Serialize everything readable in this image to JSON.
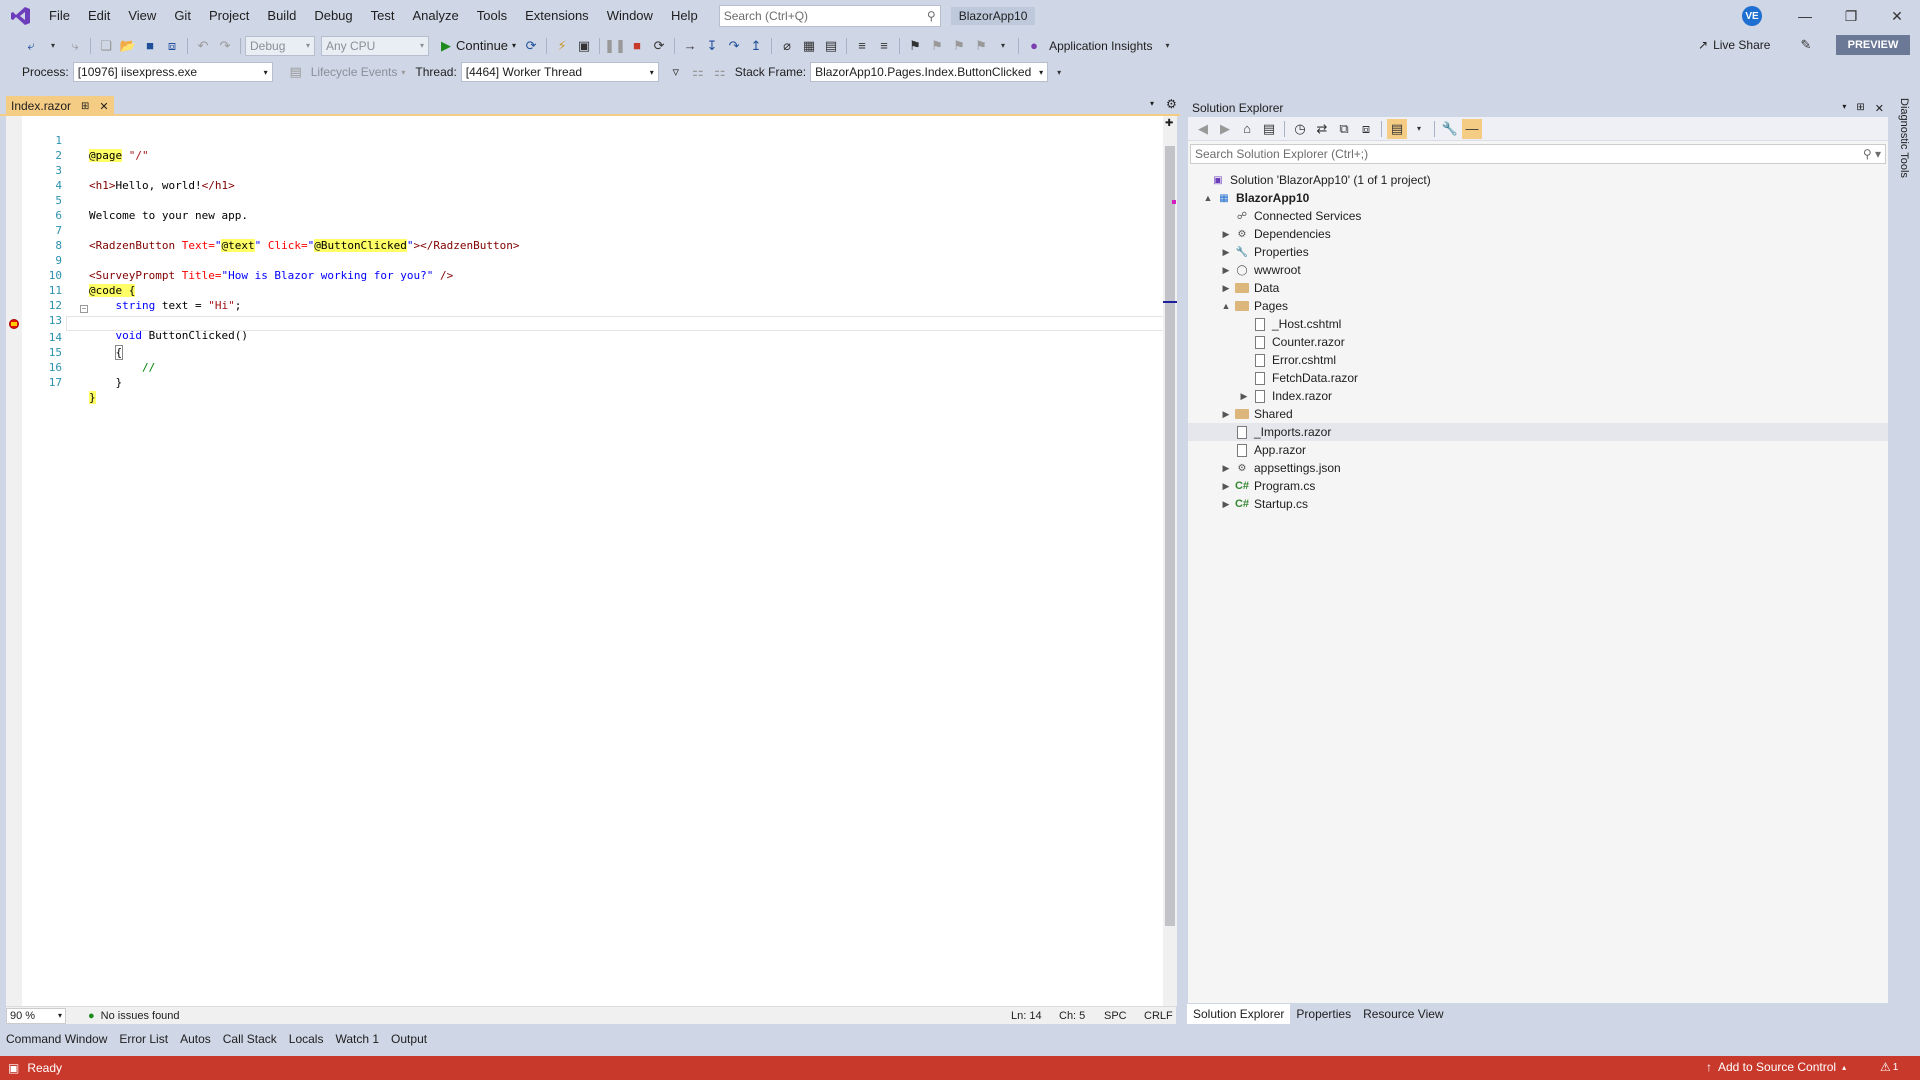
{
  "menu": {
    "items": [
      "File",
      "Edit",
      "View",
      "Git",
      "Project",
      "Build",
      "Debug",
      "Test",
      "Analyze",
      "Tools",
      "Extensions",
      "Window",
      "Help"
    ],
    "search_placeholder": "Search (Ctrl+Q)",
    "app_title": "BlazorApp10",
    "avatar": "VE"
  },
  "toolbar": {
    "config": "Debug",
    "platform": "Any CPU",
    "continue_label": "Continue",
    "app_insights": "Application Insights",
    "live_share": "Live Share",
    "preview": "PREVIEW"
  },
  "debug_toolbar": {
    "process_label": "Process:",
    "process_value": "[10976] iisexpress.exe",
    "lifecycle_label": "Lifecycle Events",
    "thread_label": "Thread:",
    "thread_value": "[4464] Worker Thread",
    "stack_label": "Stack Frame:",
    "stack_value": "BlazorApp10.Pages.Index.ButtonClicked"
  },
  "editor": {
    "tab_title": "Index.razor",
    "line_numbers": [
      "1",
      "2",
      "3",
      "4",
      "5",
      "6",
      "7",
      "8",
      "9",
      "10",
      "11",
      "12",
      "13",
      "14",
      "15",
      "16",
      "17"
    ],
    "zoom": "90 %",
    "issues": "No issues found",
    "ln": "Ln: 14",
    "ch": "Ch: 5",
    "spc": "SPC",
    "crlf": "CRLF"
  },
  "bottom_tabs": [
    "Command Window",
    "Error List",
    "Autos",
    "Call Stack",
    "Locals",
    "Watch 1",
    "Output"
  ],
  "status": {
    "ready": "Ready",
    "source_control": "Add to Source Control",
    "notifications": "1"
  },
  "solution_explorer": {
    "title": "Solution Explorer",
    "search_placeholder": "Search Solution Explorer (Ctrl+;)",
    "tree": [
      {
        "label": "Solution 'BlazorApp10' (1 of 1 project)",
        "level": 0,
        "expander": "",
        "icon": "solution-icon"
      },
      {
        "label": "BlazorApp10",
        "level": 1,
        "expander": "▲",
        "icon": "project-icon"
      },
      {
        "label": "Connected Services",
        "level": 2,
        "expander": "",
        "icon": "connected-services-icon"
      },
      {
        "label": "Dependencies",
        "level": 2,
        "expander": "▶",
        "icon": "dependencies-icon"
      },
      {
        "label": "Properties",
        "level": 2,
        "expander": "▶",
        "icon": "properties-icon"
      },
      {
        "label": "wwwroot",
        "level": 2,
        "expander": "▶",
        "icon": "globe-icon"
      },
      {
        "label": "Data",
        "level": 2,
        "expander": "▶",
        "icon": "folder-icon"
      },
      {
        "label": "Pages",
        "level": 2,
        "expander": "▲",
        "icon": "folder-icon"
      },
      {
        "label": "_Host.cshtml",
        "level": 3,
        "expander": "",
        "icon": "file-icon"
      },
      {
        "label": "Counter.razor",
        "level": 3,
        "expander": "",
        "icon": "file-icon"
      },
      {
        "label": "Error.cshtml",
        "level": 3,
        "expander": "",
        "icon": "file-icon"
      },
      {
        "label": "FetchData.razor",
        "level": 3,
        "expander": "",
        "icon": "file-icon"
      },
      {
        "label": "Index.razor",
        "level": 3,
        "expander": "▶",
        "icon": "file-icon"
      },
      {
        "label": "Shared",
        "level": 2,
        "expander": "▶",
        "icon": "folder-icon"
      },
      {
        "label": "_Imports.razor",
        "level": 2,
        "expander": "",
        "icon": "file-icon"
      },
      {
        "label": "App.razor",
        "level": 2,
        "expander": "",
        "icon": "file-icon"
      },
      {
        "label": "appsettings.json",
        "level": 2,
        "expander": "▶",
        "icon": "json-icon"
      },
      {
        "label": "Program.cs",
        "level": 2,
        "expander": "▶",
        "icon": "csharp-icon"
      },
      {
        "label": "Startup.cs",
        "level": 2,
        "expander": "▶",
        "icon": "csharp-icon"
      }
    ],
    "bottom_tabs": [
      "Solution Explorer",
      "Properties",
      "Resource View"
    ]
  },
  "diagnostic_tools": "Diagnostic Tools",
  "code": {
    "l1_dir": "@page",
    "l1_str": "\"/\"",
    "l3_open": "<h1>",
    "l3_text": "Hello, world!",
    "l3_close": "</h1>",
    "l5": "Welcome to your new app.",
    "l7_open": "<RadzenButton",
    "l7_attr1": " Text=",
    "l7_q1": "\"",
    "l7_dir1": "@text",
    "l7_q2": "\"",
    "l7_attr2": " Click=",
    "l7_q3": "\"",
    "l7_dir2": "@ButtonClicked",
    "l7_q4": "\"",
    "l7_close": "></RadzenButton>",
    "l9_open": "<SurveyPrompt",
    "l9_attr": " Title=",
    "l9_str": "\"How is Blazor working for you?\"",
    "l9_close": " />",
    "l10_dir": "@code",
    "l10_brace": " {",
    "l11_kw": "string",
    "l11_rest": " text = ",
    "l11_str": "\"Hi\"",
    "l11_end": ";",
    "l13_kw": "void",
    "l13_rest": " ButtonClicked()",
    "l14": "{",
    "l15": "//",
    "l16": "}",
    "l17": "}"
  }
}
